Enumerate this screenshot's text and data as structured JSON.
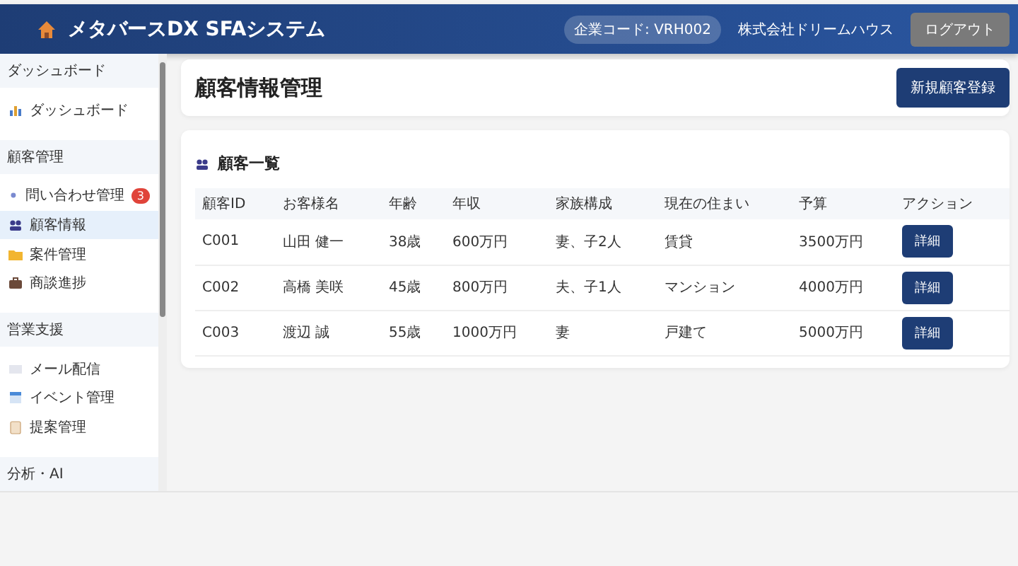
{
  "header": {
    "title": "メタバースDX SFAシステム",
    "company_code": "企業コード: VRH002",
    "company_name": "株式会社ドリームハウス",
    "logout": "ログアウト"
  },
  "sidebar": {
    "sections": [
      {
        "title": "ダッシュボード",
        "items": [
          {
            "label": "ダッシュボード",
            "selected": false
          }
        ]
      },
      {
        "title": "顧客管理",
        "items": [
          {
            "label": "問い合わせ管理",
            "selected": false,
            "badge": "3"
          },
          {
            "label": "顧客情報",
            "selected": true
          },
          {
            "label": "案件管理",
            "selected": false
          },
          {
            "label": "商談進捗",
            "selected": false
          }
        ]
      },
      {
        "title": "営業支援",
        "items": [
          {
            "label": "メール配信",
            "selected": false
          },
          {
            "label": "イベント管理",
            "selected": false
          },
          {
            "label": "提案管理",
            "selected": false
          }
        ]
      },
      {
        "title": "分析・AI"
      }
    ]
  },
  "page": {
    "title": "顧客情報管理",
    "new_button": "新規顧客登録"
  },
  "table": {
    "title": "顧客一覧",
    "columns": [
      "顧客ID",
      "お客様名",
      "年齢",
      "年収",
      "家族構成",
      "現在の住まい",
      "予算",
      "アクション"
    ],
    "rows": [
      {
        "cells": [
          "C001",
          "山田 健一",
          "38歳",
          "600万円",
          "妻、子2人",
          "賃貸",
          "3500万円"
        ],
        "action": "詳細"
      },
      {
        "cells": [
          "C002",
          "高橋 美咲",
          "45歳",
          "800万円",
          "夫、子1人",
          "マンション",
          "4000万円"
        ],
        "action": "詳細"
      },
      {
        "cells": [
          "C003",
          "渡辺 誠",
          "55歳",
          "1000万円",
          "妻",
          "戸建て",
          "5000万円"
        ],
        "action": "詳細"
      }
    ]
  }
}
